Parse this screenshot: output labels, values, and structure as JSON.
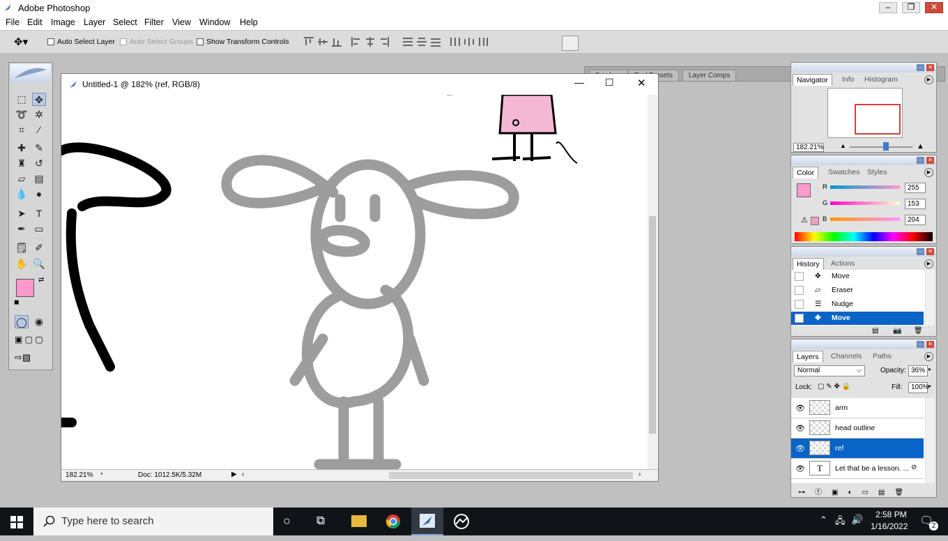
{
  "window": {
    "title": "Adobe Photoshop"
  },
  "menubar": {
    "items": [
      "File",
      "Edit",
      "Image",
      "Layer",
      "Select",
      "Filter",
      "View",
      "Window",
      "Help"
    ]
  },
  "options": {
    "auto_select_layer": "Auto Select Layer",
    "auto_select_groups": "Auto Select Groups",
    "show_transform_controls": "Show Transform Controls",
    "well_tabs": [
      "Brushes",
      "Tool Presets",
      "Layer Comps"
    ]
  },
  "toolbox": {
    "foreground_color": "#ff99cc",
    "background_color": "#ffffff"
  },
  "document": {
    "title": "Untitled-1 @ 182% (ref, RGB/8)",
    "zoom": "182.21%",
    "doc_size": "Doc: 1012.5K/5.32M"
  },
  "navigator": {
    "tabs": [
      "Navigator",
      "Info",
      "Histogram"
    ],
    "zoom": "182.21%"
  },
  "color": {
    "tabs": [
      "Color",
      "Swatches",
      "Styles"
    ],
    "channels": [
      {
        "label": "R",
        "value": "255"
      },
      {
        "label": "G",
        "value": "153"
      },
      {
        "label": "B",
        "value": "204"
      }
    ],
    "swatch": "#ff99cc"
  },
  "history": {
    "tabs": [
      "History",
      "Actions"
    ],
    "items": [
      "Move",
      "Eraser",
      "Nudge",
      "Move"
    ]
  },
  "layers": {
    "tabs": [
      "Layers",
      "Channels",
      "Paths"
    ],
    "blend_mode": "Normal",
    "opacity_label": "Opacity:",
    "opacity": "36%",
    "lock_label": "Lock:",
    "fill_label": "Fill:",
    "fill": "100%",
    "items": [
      "arm",
      "head outline",
      "ref",
      "Let that be a lesson. ..."
    ]
  },
  "taskbar": {
    "search_placeholder": "Type here to search",
    "time": "2:58 PM",
    "date": "1/16/2022",
    "notification_count": "2"
  }
}
